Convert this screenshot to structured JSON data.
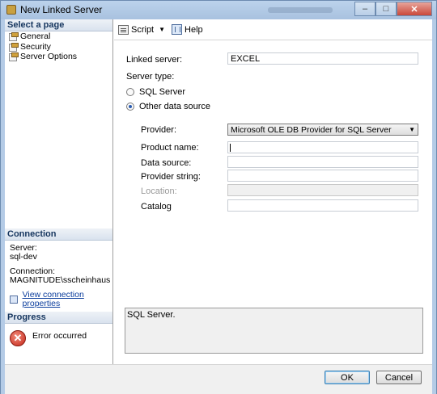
{
  "window": {
    "title": "New Linked Server"
  },
  "left": {
    "select_page_header": "Select a page",
    "pages": [
      {
        "label": "General"
      },
      {
        "label": "Security"
      },
      {
        "label": "Server Options"
      }
    ],
    "connection_header": "Connection",
    "server_label": "Server:",
    "server_value": "sql-dev",
    "connection_label": "Connection:",
    "connection_value": "MAGNITUDE\\sscheinhaus",
    "view_connection_link": "View connection properties",
    "progress_header": "Progress",
    "progress_status": "Error occurred"
  },
  "toolbar": {
    "script_label": "Script",
    "help_label": "Help"
  },
  "form": {
    "linked_server_label": "Linked server:",
    "linked_server_value": "EXCEL",
    "server_type_label": "Server type:",
    "sql_server_radio": "SQL Server",
    "other_source_radio": "Other data source",
    "provider_label": "Provider:",
    "provider_value": "Microsoft OLE DB Provider for SQL Server",
    "product_name_label": "Product name:",
    "product_name_value": "",
    "data_source_label": "Data source:",
    "data_source_value": "",
    "provider_string_label": "Provider string:",
    "provider_string_value": "",
    "location_label": "Location:",
    "location_value": "",
    "catalog_label": "Catalog",
    "catalog_value": "",
    "description": "SQL Server."
  },
  "buttons": {
    "ok": "OK",
    "cancel": "Cancel"
  }
}
